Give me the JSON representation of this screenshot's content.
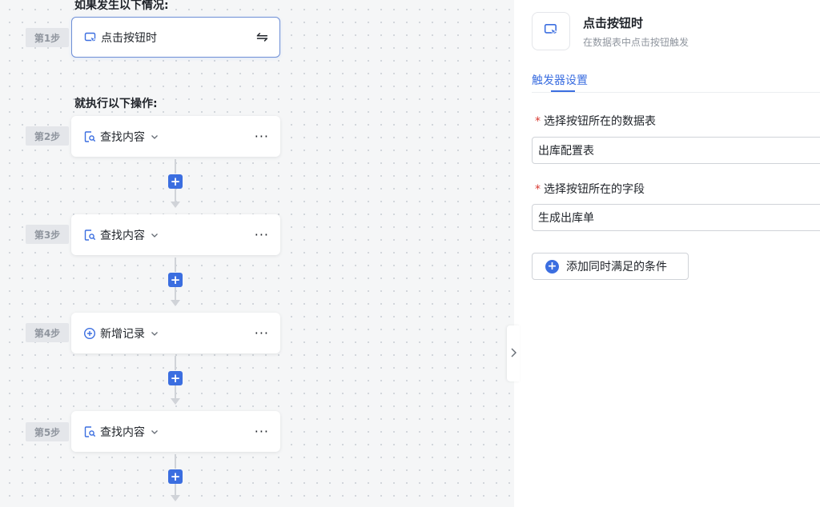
{
  "canvas": {
    "trigger_heading": "如果发生以下情况:",
    "action_heading": "就执行以下操作:",
    "trigger_step": {
      "step": "第1步",
      "label": "点击按钮时",
      "icon": "cursor-click-icon"
    },
    "action_steps": [
      {
        "step": "第2步",
        "label": "查找内容",
        "icon": "find-record-icon"
      },
      {
        "step": "第3步",
        "label": "查找内容",
        "icon": "find-record-icon"
      },
      {
        "step": "第4步",
        "label": "新增记录",
        "icon": "add-circle-icon"
      },
      {
        "step": "第5步",
        "label": "查找内容",
        "icon": "find-record-icon"
      }
    ],
    "more_label": "···",
    "swap_label": "⇋",
    "add_label": "+"
  },
  "panel": {
    "title": "点击按钮时",
    "subtitle": "在数据表中点击按钮触发",
    "tab": "触发器设置",
    "fields": [
      {
        "label": "选择按钮所在的数据表",
        "value": "出库配置表"
      },
      {
        "label": "选择按钮所在的字段",
        "value": "生成出库单"
      }
    ],
    "required_mark": "*",
    "add_condition_label": "添加同时满足的条件"
  },
  "colors": {
    "accent": "#3b6ee0",
    "required": "#d83931",
    "canvas_bg": "#f5f6f7"
  }
}
